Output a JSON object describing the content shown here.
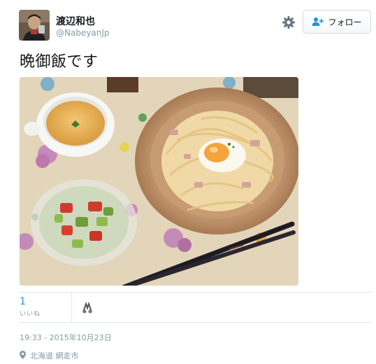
{
  "user": {
    "display_name": "渡辺和也",
    "screen_name": "@NabeyanJp"
  },
  "actions": {
    "follow_label": "フォロー"
  },
  "tweet": {
    "text": "晩御飯です"
  },
  "stats": {
    "likes_count": "1",
    "likes_label": "いいね"
  },
  "timestamp": "19:33 - 2015年10月23日",
  "location": "北海道 網走市",
  "colors": {
    "link": "#1b95e0",
    "muted": "#8899a6",
    "border": "#e1e8ed"
  },
  "icons": [
    "gear-icon",
    "follow-person-icon",
    "location-pin-icon"
  ]
}
